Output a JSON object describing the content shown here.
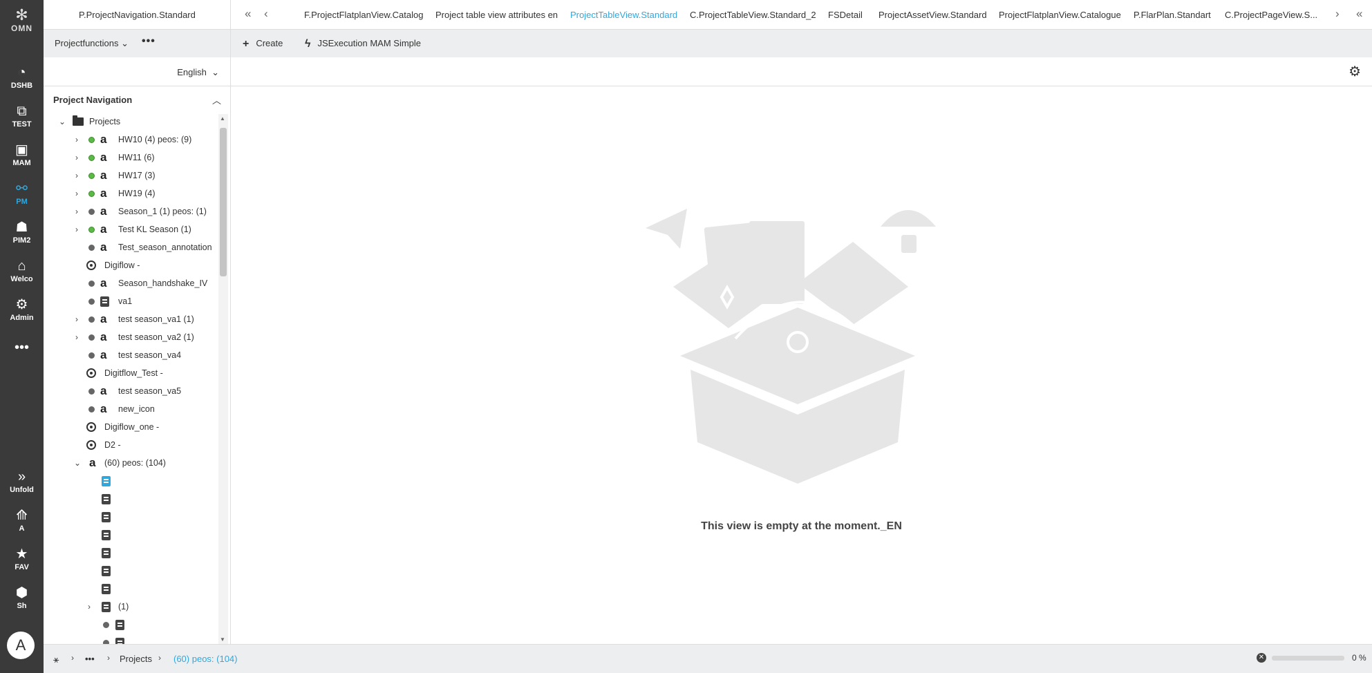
{
  "rail": {
    "logo_text": "OMN",
    "items": [
      {
        "label": "DSHB",
        "icon": "dashboard-icon"
      },
      {
        "label": "TEST",
        "icon": "test-icon"
      },
      {
        "label": "MAM",
        "icon": "media-icon"
      },
      {
        "label": "PM",
        "icon": "project-icon",
        "active": true
      },
      {
        "label": "PIM2",
        "icon": "pim-icon"
      },
      {
        "label": "Welco",
        "icon": "home-icon"
      },
      {
        "label": "Admin",
        "icon": "gear-icon"
      }
    ],
    "more_label": "•••",
    "bottom_items": [
      {
        "label": "Unfold",
        "icon": "double-chevron-right-icon"
      },
      {
        "label": "A",
        "icon": "tree-icon"
      },
      {
        "label": "FAV",
        "icon": "star-icon"
      },
      {
        "label": "Sh",
        "icon": "box-icon"
      }
    ],
    "avatar_letter": "A"
  },
  "header": {
    "left_title": "P.ProjectNavigation.Standard",
    "tabs": [
      {
        "label": "F.ProjectFlatplanView.Catalog"
      },
      {
        "label": "Project table view attributes en"
      },
      {
        "label": "ProjectTableView.Standard",
        "active": true
      },
      {
        "label": "C.ProjectTableView.Standard_2"
      },
      {
        "label": "FSDetail"
      },
      {
        "label": "ProjectAssetView.Standard"
      },
      {
        "label": "ProjectFlatplanView.Catalogue"
      },
      {
        "label": "P.FlarPlan.Standart"
      },
      {
        "label": "C.ProjectPageView.S..."
      }
    ]
  },
  "toolbar": {
    "functions_label": "Projectfunctions",
    "more_label": "•••",
    "create_label": "Create",
    "jsexec_label": "JSExecution MAM Simple"
  },
  "language": {
    "selected": "English"
  },
  "tree": {
    "title": "Project Navigation",
    "root_label": "Projects",
    "rows": [
      {
        "label": "HW10 (4) peos: (9)",
        "status": "green",
        "kind": "a",
        "expand": true
      },
      {
        "label": "HW11 (6)",
        "status": "green",
        "kind": "a",
        "expand": true
      },
      {
        "label": "HW17 (3)",
        "status": "green",
        "kind": "a",
        "expand": true
      },
      {
        "label": "HW19 (4)",
        "status": "green",
        "kind": "a",
        "expand": true
      },
      {
        "label": "Season_1 (1) peos: (1)",
        "status": "grey",
        "kind": "a",
        "expand": true
      },
      {
        "label": "Test KL Season (1)",
        "status": "green",
        "kind": "a",
        "expand": true
      },
      {
        "label": "Test_season_annotation",
        "status": "grey",
        "kind": "a",
        "expand": false
      },
      {
        "label": "Digiflow -",
        "status": "none",
        "kind": "flow",
        "expand": false
      },
      {
        "label": "Season_handshake_IV",
        "status": "grey",
        "kind": "a",
        "expand": false
      },
      {
        "label": "va1",
        "status": "grey",
        "kind": "book",
        "expand": false
      },
      {
        "label": "test season_va1 (1)",
        "status": "grey",
        "kind": "a",
        "expand": true
      },
      {
        "label": "test season_va2 (1)",
        "status": "grey",
        "kind": "a",
        "expand": true
      },
      {
        "label": "test season_va4",
        "status": "grey",
        "kind": "a",
        "expand": false
      },
      {
        "label": "Digitflow_Test -",
        "status": "none",
        "kind": "flow",
        "expand": false
      },
      {
        "label": "test season_va5",
        "status": "grey",
        "kind": "a",
        "expand": false
      },
      {
        "label": "new_icon",
        "status": "grey",
        "kind": "a",
        "expand": false
      },
      {
        "label": "Digiflow_one -",
        "status": "none",
        "kind": "flow",
        "expand": false
      },
      {
        "label": "D2 -",
        "status": "none",
        "kind": "flow",
        "expand": false
      },
      {
        "label": "(60) peos: (104)",
        "status": "none",
        "kind": "a",
        "expand": "open"
      }
    ],
    "child_count_label": "(1)"
  },
  "main": {
    "empty_message": "This view is empty at the moment._EN"
  },
  "breadcrumb": {
    "more": "•••",
    "projects": "Projects",
    "current": "(60) peos: (104)"
  },
  "progress": {
    "value": 0,
    "label": "0 %"
  },
  "colors": {
    "accent": "#2fa8e0",
    "rail_bg": "#3a3a3a",
    "status_green": "#5bb946"
  }
}
